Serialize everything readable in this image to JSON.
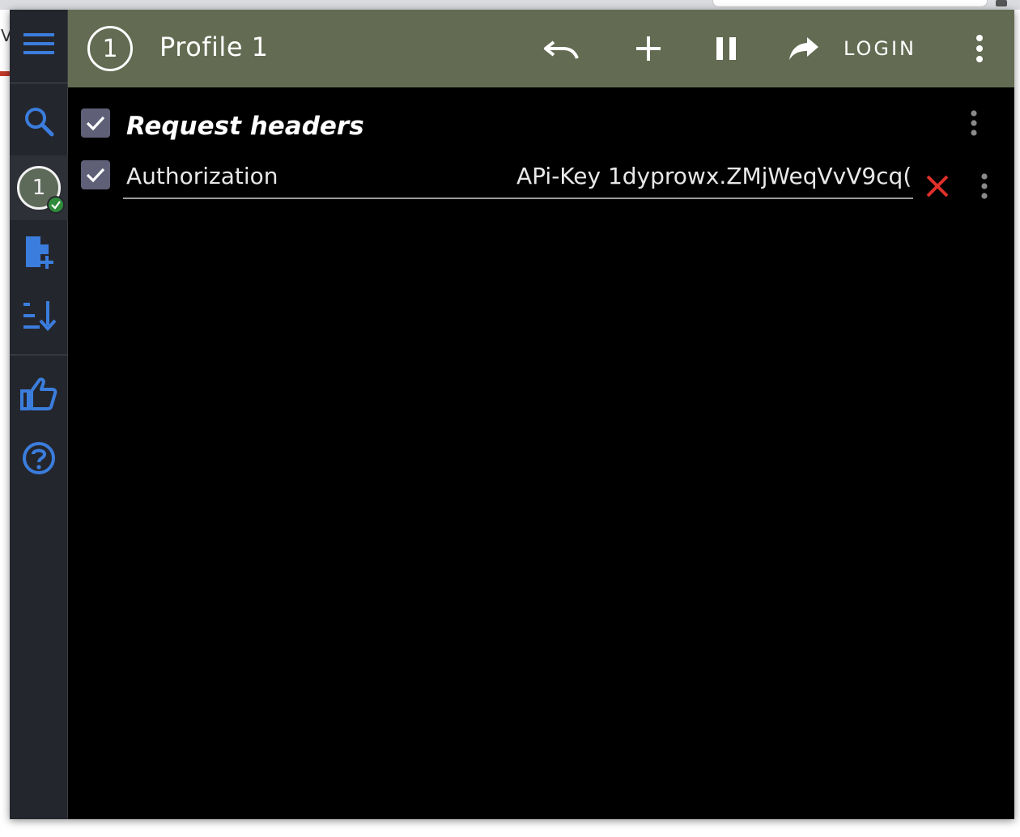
{
  "topbar": {
    "profile_number": "1",
    "profile_name": "Profile 1",
    "login_label": "LOGIN"
  },
  "sidebar": {
    "profile_badge_number": "1",
    "icons": [
      "menu-icon",
      "search-icon",
      "profile-badge",
      "add-file-icon",
      "sort-icon",
      "thumbs-up-icon",
      "help-icon"
    ]
  },
  "section": {
    "title": "Request headers",
    "enabled": true
  },
  "headers": [
    {
      "name": "Authorization",
      "value": "APi-Key 1dyprowx.ZMjWeqVvV9cq(",
      "enabled": true
    }
  ],
  "colors": {
    "accent_blue": "#3b7ddd",
    "topbar_bg": "#636b52",
    "sidebar_bg": "#24262d",
    "checkbox_bg": "#5f6077",
    "delete_red": "#e0302a",
    "status_green": "#2e8b3a"
  },
  "background_page": {
    "partial_letter": "V"
  }
}
